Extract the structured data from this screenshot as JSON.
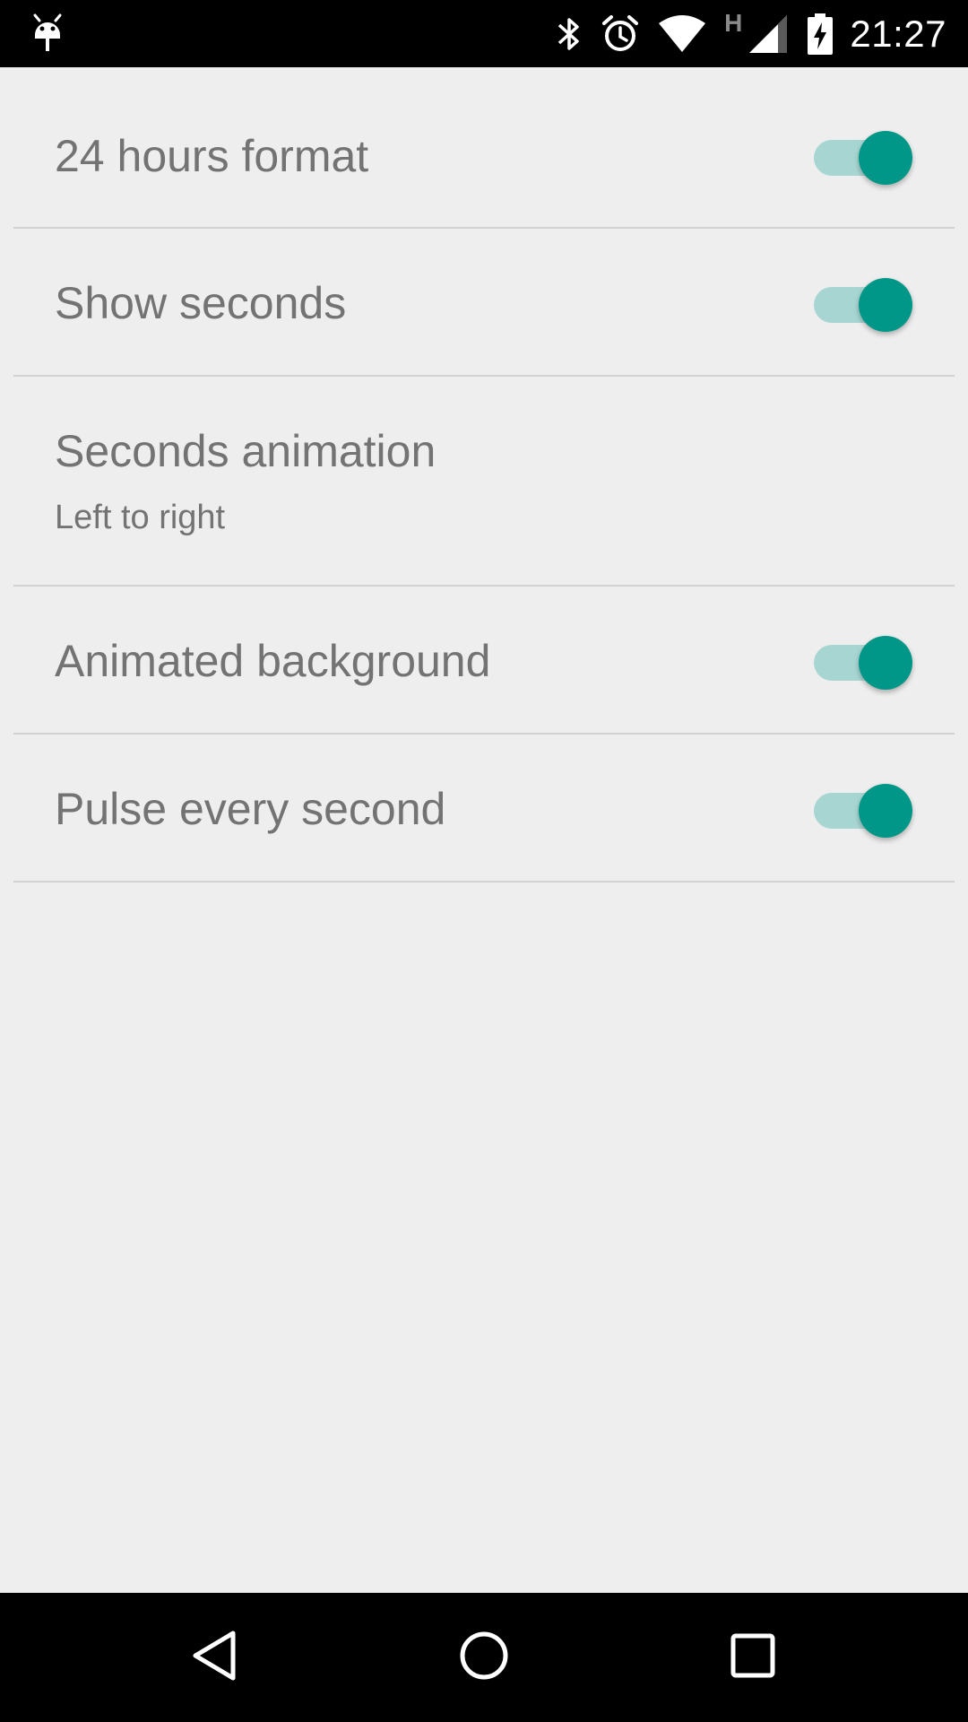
{
  "status_bar": {
    "time": "21:27",
    "network_label": "H",
    "icons": [
      "android-debug-icon",
      "bluetooth-icon",
      "alarm-icon",
      "wifi-icon",
      "network-type-h",
      "signal-icon",
      "battery-charging-icon"
    ]
  },
  "settings": [
    {
      "title": "24 hours format",
      "type": "switch",
      "checked": true
    },
    {
      "title": "Show seconds",
      "type": "switch",
      "checked": true
    },
    {
      "title": "Seconds animation",
      "summary": "Left to right",
      "type": "list"
    },
    {
      "title": "Animated background",
      "type": "switch",
      "checked": true
    },
    {
      "title": "Pulse every second",
      "type": "switch",
      "checked": true
    }
  ],
  "nav_bar": {
    "buttons": [
      "back-icon",
      "home-icon",
      "recents-icon"
    ]
  },
  "colors": {
    "accent": "#009688",
    "track": "#a7d6d2",
    "background": "#eeeeee",
    "text": "#737373",
    "divider": "#d2d2d2"
  }
}
